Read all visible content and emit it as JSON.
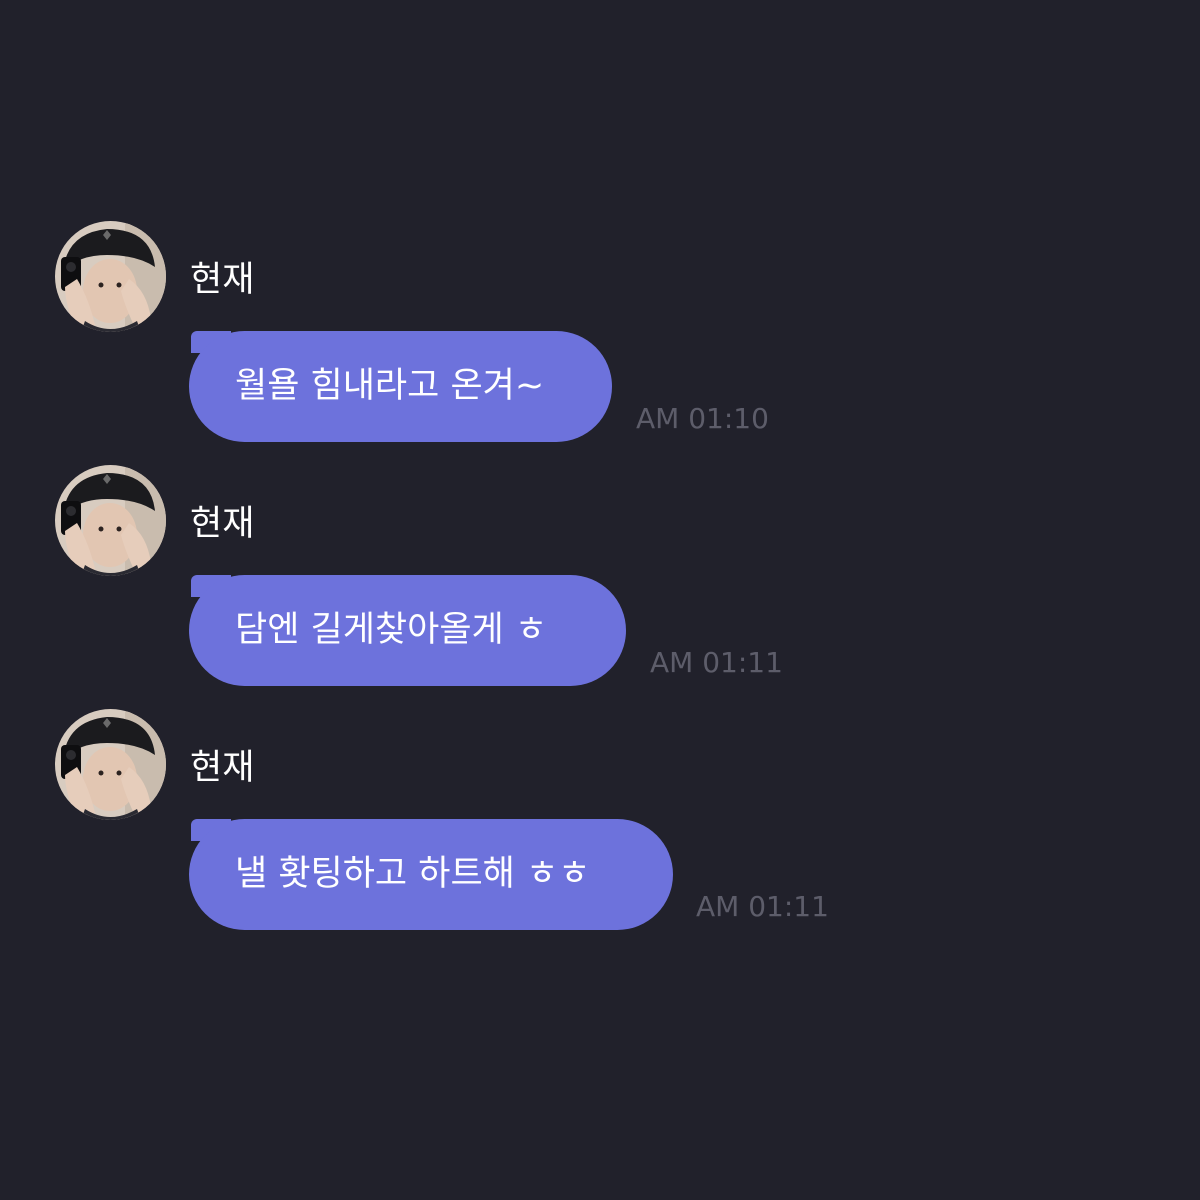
{
  "conversation": {
    "messages": [
      {
        "sender": "현재",
        "avatar_icon": "profile-photo",
        "text": "월욜 힘내라고 온겨~",
        "time": "AM 01:10"
      },
      {
        "sender": "현재",
        "avatar_icon": "profile-photo",
        "text": "담엔 길게찾아올게 ㅎ",
        "time": "AM 01:11"
      },
      {
        "sender": "현재",
        "avatar_icon": "profile-photo",
        "text": "낼 홧팅하고 하트해 ㅎㅎ",
        "time": "AM 01:11"
      }
    ]
  },
  "colors": {
    "background": "#21212b",
    "bubble": "#6d72dc",
    "name_text": "#ffffff",
    "message_text": "#ffffff",
    "timestamp_text": "#5d5d6a"
  }
}
